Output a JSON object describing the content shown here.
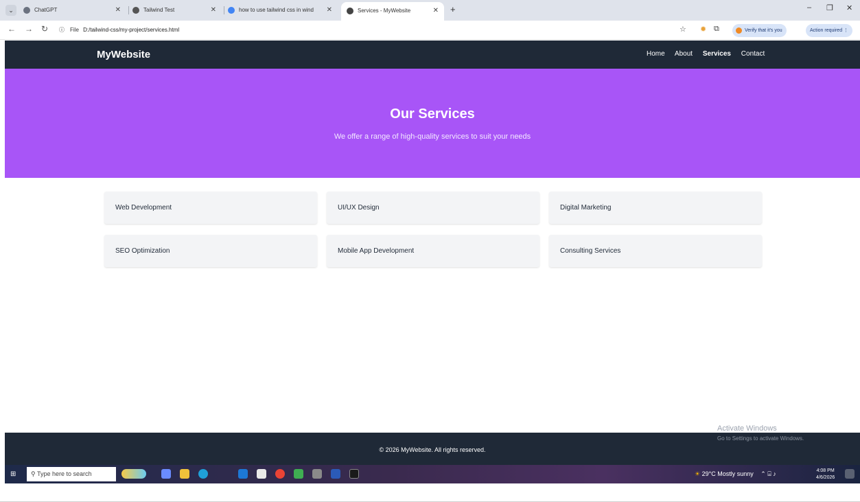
{
  "browser": {
    "tabs": [
      {
        "title": "ChatGPT",
        "active": false
      },
      {
        "title": "Tailwind Test",
        "active": false
      },
      {
        "title": "how to use tailwind css in wind",
        "active": false
      },
      {
        "title": "Services - MyWebsite",
        "active": true
      }
    ],
    "url_scheme": "File",
    "url": "D:/tailwind-css/my-project/services.html",
    "verify_label": "Verify that it's you",
    "action_label": "Action required"
  },
  "site": {
    "brand": "MyWebsite",
    "nav": [
      "Home",
      "About",
      "Services",
      "Contact"
    ],
    "current_nav": "Services",
    "hero": {
      "title": "Our Services",
      "subtitle": "We offer a range of high-quality services to suit your needs"
    },
    "services": [
      "Web Development",
      "UI/UX Design",
      "Digital Marketing",
      "SEO Optimization",
      "Mobile App Development",
      "Consulting Services"
    ],
    "footer": "© 2026 MyWebsite. All rights reserved."
  },
  "os": {
    "activation_title": "Activate Windows",
    "activation_sub": "Go to Settings to activate Windows.",
    "search_placeholder": "Type here to search",
    "weather": "29°C  Mostly sunny",
    "time": "4:08 PM",
    "date": "4/6/2026"
  },
  "colors": {
    "nav_bg": "#1f2937",
    "hero_bg": "#a855f7",
    "card_bg": "#f3f4f6"
  }
}
